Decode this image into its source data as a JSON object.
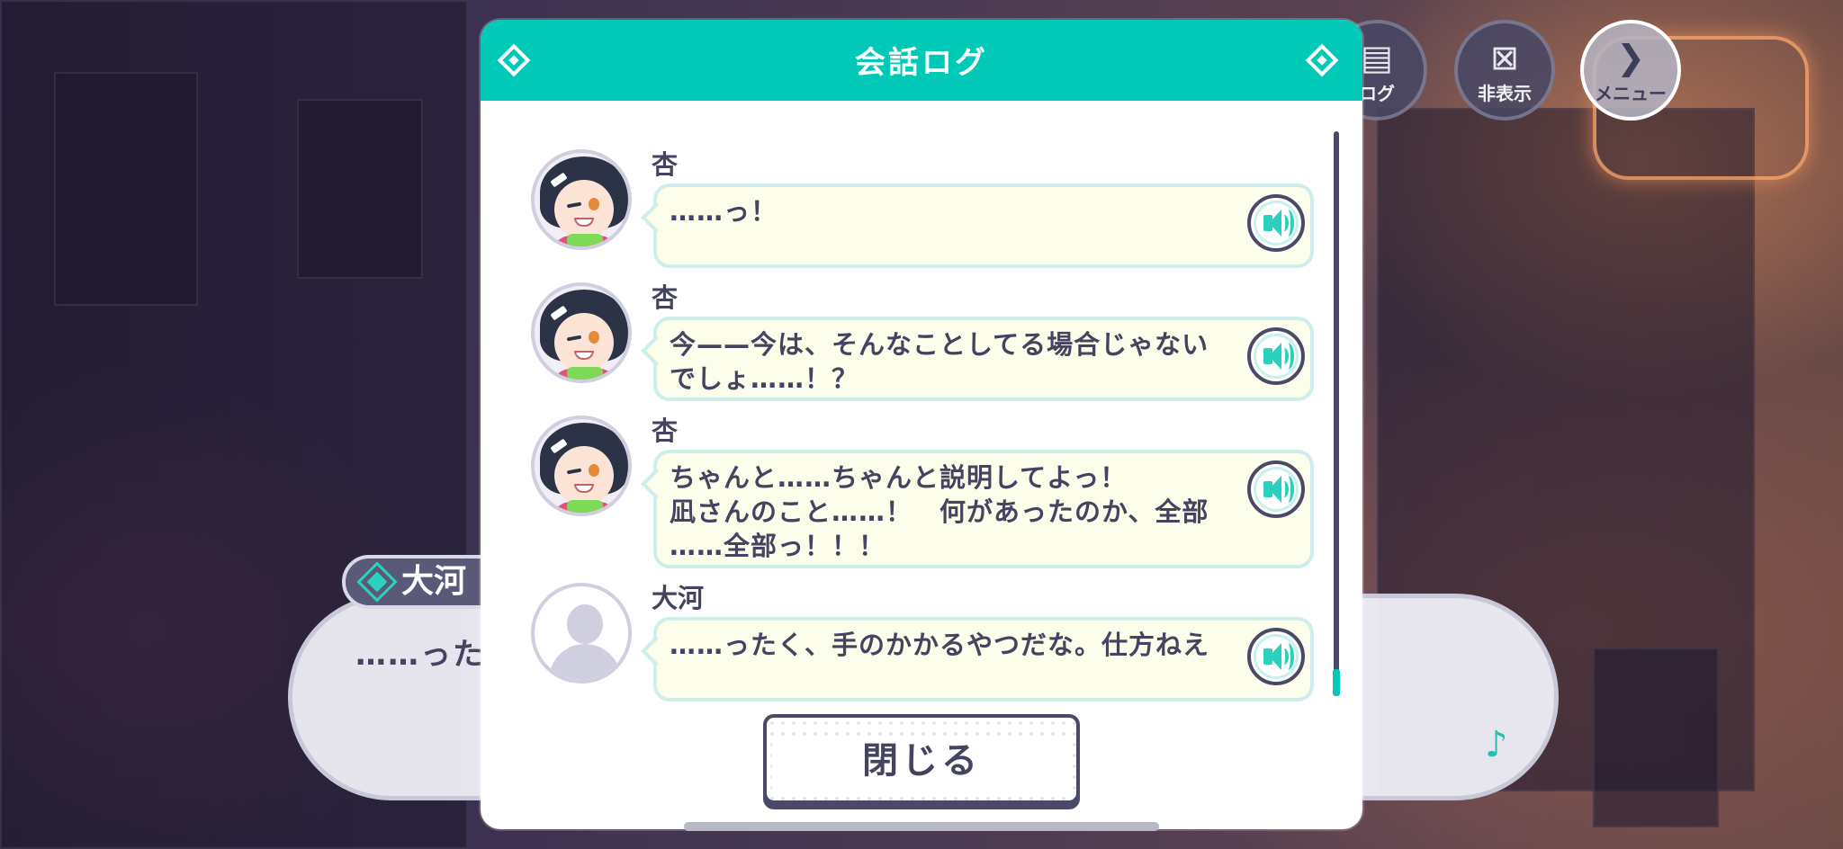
{
  "app": {
    "accent_color": "#00c9b8"
  },
  "top_buttons": [
    {
      "label": "ログ",
      "icon": "chat-bubble-icon"
    },
    {
      "label": "非表示",
      "icon": "hide-icon"
    },
    {
      "label": "メニュー",
      "icon": "chevron-right-icon"
    }
  ],
  "dialogue": {
    "speaker": "大河",
    "text": "……った"
  },
  "modal": {
    "title": "会話ログ",
    "close_label": "閉じる"
  },
  "log": [
    {
      "speaker": "杏",
      "avatar": "an-portrait",
      "lines": [
        "……っ！"
      ]
    },
    {
      "speaker": "杏",
      "avatar": "an-portrait",
      "lines": [
        "今——今は、そんなことしてる場合じゃない",
        "でしょ……！？"
      ]
    },
    {
      "speaker": "杏",
      "avatar": "an-portrait",
      "lines": [
        "ちゃんと……ちゃんと説明してよっ！",
        "凪さんのこと……！　何があったのか、全部",
        "……全部っ！！！"
      ]
    },
    {
      "speaker": "大河",
      "avatar": "blank-avatar",
      "lines": [
        "……ったく、手のかかるやつだな。仕方ねえ"
      ]
    }
  ]
}
